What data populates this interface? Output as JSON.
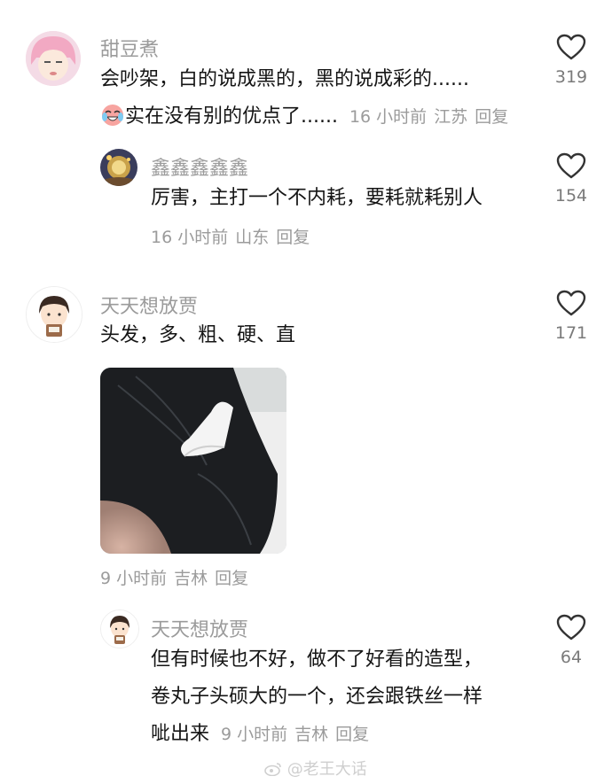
{
  "comments": [
    {
      "username": "甜豆煮",
      "text_line1": "会吵架，白的说成黑的，黑的说成彩的......",
      "text_line2": "实在没有别的优点了......",
      "time": "16 小时前",
      "location": "江苏",
      "reply": "回复",
      "likes": "319",
      "emoji_icon": "crying-laughing-emoji-icon"
    },
    {
      "username": "鑫鑫鑫鑫鑫",
      "text": "厉害，主打一个不内耗，要耗就耗别人",
      "time": "16 小时前",
      "location": "山东",
      "reply": "回复",
      "likes": "154"
    },
    {
      "username": "天天想放贾",
      "text": "头发，多、粗、硬、直",
      "time": "9 小时前",
      "location": "吉林",
      "reply": "回复",
      "likes": "171"
    },
    {
      "username": "天天想放贾",
      "text_line1": "但有时候也不好，做不了好看的造型，",
      "text_line2": "卷丸子头硕大的一个，还会跟铁丝一样",
      "text_line3": "呲出来",
      "time": "9 小时前",
      "location": "吉林",
      "reply": "回复",
      "likes": "64"
    }
  ],
  "watermark": "@老王大话",
  "colors": {
    "text": "#151515",
    "meta": "#9b9b9b",
    "icon": "#333333"
  }
}
